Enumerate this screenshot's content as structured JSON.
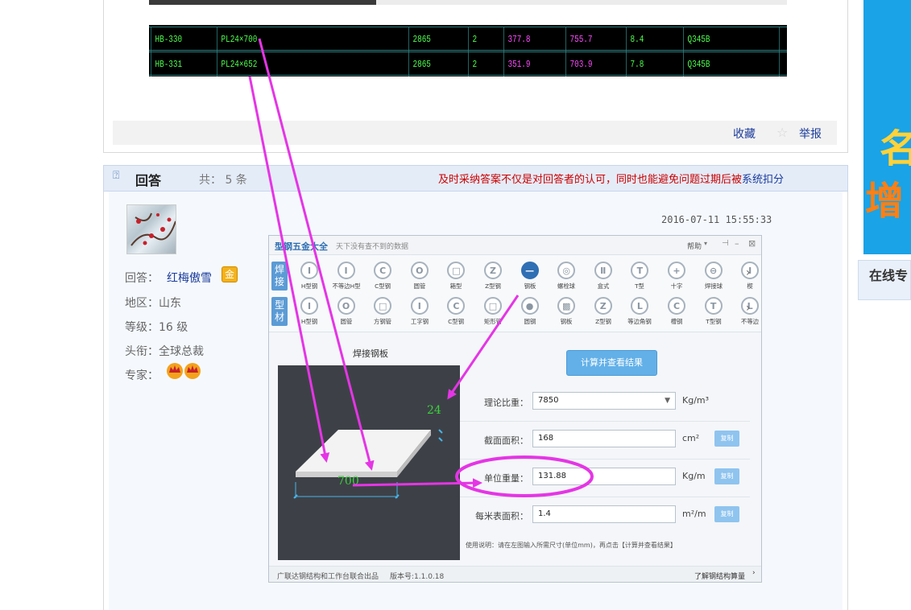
{
  "cad_table": {
    "rows": [
      {
        "id": "HB-330",
        "plate": "PL24×700",
        "length": "2865",
        "count": "2",
        "weight1": "377.8",
        "weight2": "755.7",
        "area": "8.4",
        "grade": "Q345B"
      },
      {
        "id": "HB-331",
        "plate": "PL24×652",
        "length": "2865",
        "count": "2",
        "weight1": "351.9",
        "weight2": "703.9",
        "area": "7.8",
        "grade": "Q345B"
      }
    ]
  },
  "question_footer": {
    "favorite": "收藏",
    "report": "举报"
  },
  "answers": {
    "title": "回答",
    "count_text": "共： 5 条",
    "notice_a": "及时采纳答案不仅是对回答者的认可，同时也能避免问题过期后被",
    "notice_link": "系统扣分",
    "timestamp": "2016-07-11 15:55:33"
  },
  "answerer": {
    "answer_label": "回答：",
    "name": "红梅傲雪",
    "badge": "金",
    "region": "地区：山东",
    "level": "等级：16 级",
    "title": "头衔：全球总裁",
    "expert_label": "专家："
  },
  "app": {
    "title": "型钢五金大全",
    "subtitle": "天下没有查不到的数据",
    "help": "帮助",
    "tab_weld": "焊接",
    "tab_profile": "型材",
    "row1": [
      {
        "label": "H型钢",
        "glyph": "I"
      },
      {
        "label": "不等边H型",
        "glyph": "I"
      },
      {
        "label": "C型钢",
        "glyph": "C"
      },
      {
        "label": "圆管",
        "glyph": "O"
      },
      {
        "label": "箱型",
        "glyph": "□"
      },
      {
        "label": "Z型钢",
        "glyph": "Z"
      },
      {
        "label": "钢板",
        "glyph": "—"
      },
      {
        "label": "螺栓球",
        "glyph": "◎"
      },
      {
        "label": "盒式",
        "glyph": "Ⅱ"
      },
      {
        "label": "T型",
        "glyph": "T"
      },
      {
        "label": "十字",
        "glyph": "+"
      },
      {
        "label": "焊接球",
        "glyph": "⊖"
      },
      {
        "label": "楔",
        "glyph": "I"
      }
    ],
    "row2": [
      {
        "label": "H型钢",
        "glyph": "I"
      },
      {
        "label": "圆管",
        "glyph": "O"
      },
      {
        "label": "方钢管",
        "glyph": "□"
      },
      {
        "label": "工字钢",
        "glyph": "I"
      },
      {
        "label": "C型钢",
        "glyph": "C"
      },
      {
        "label": "矩形管",
        "glyph": "□"
      },
      {
        "label": "圆钢",
        "glyph": "●"
      },
      {
        "label": "钢板",
        "glyph": "▩"
      },
      {
        "label": "Z型钢",
        "glyph": "Z"
      },
      {
        "label": "等边角钢",
        "glyph": "L"
      },
      {
        "label": "槽钢",
        "glyph": "C"
      },
      {
        "label": "T型钢",
        "glyph": "T"
      },
      {
        "label": "不等边",
        "glyph": "L"
      }
    ],
    "preview_title": "焊接钢板",
    "dim_thickness": "24",
    "dim_width": "700",
    "calc_button": "计算并查看结果",
    "fields": [
      {
        "label": "理论比重：",
        "value": "7850",
        "unit": "Kg/m³",
        "dropdown": true
      },
      {
        "label": "截面面积：",
        "value": "168",
        "unit": "cm²",
        "copy": "复制"
      },
      {
        "label": "单位重量：",
        "value": "131.88",
        "unit": "Kg/m",
        "copy": "复制"
      },
      {
        "label": "每米表面积：",
        "value": "1.4",
        "unit": "m²/m",
        "copy": "复制"
      }
    ],
    "usage_note": "使用说明：请在左图输入所需尺寸(单位mm)，再点击【计算并查看结果】",
    "footer_left": "广联达钢结构和工作台联合出品",
    "footer_version": "版本号:1.1.0.18",
    "footer_right": "了解钢结构算量"
  },
  "sidebar": {
    "ad_text_1": "名",
    "ad_text_2": "增",
    "online_label": "在线专"
  },
  "colors": {
    "annotation": "#e535e5",
    "link": "#1b3b9b",
    "notice": "#cc0000",
    "cad_green": "#4cff4c",
    "cad_magenta": "#ff4cff",
    "app_blue": "#2f6fb3"
  }
}
